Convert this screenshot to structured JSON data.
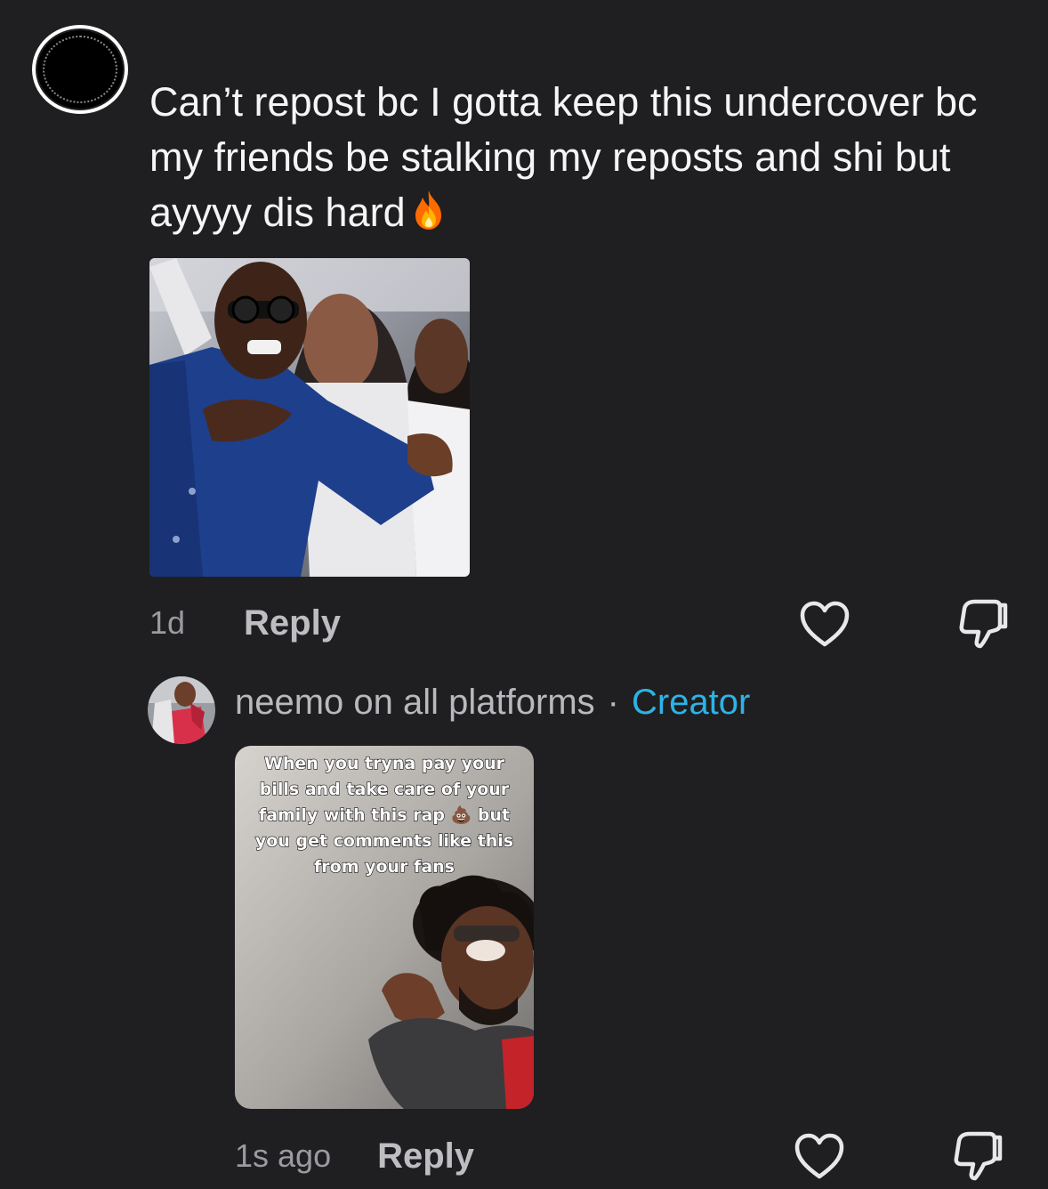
{
  "comments": [
    {
      "text": "Can’t repost bc I gotta keep this undercover bc my friends be stalking my reposts and shi but ayyyy dis hard",
      "emoji_icon": "fire-icon",
      "time": "1d",
      "reply_label": "Reply"
    },
    {
      "username": "neemo on all platforms",
      "separator": "·",
      "badge": "Creator",
      "video_caption": "When you tryna pay your bills and take care of your family with this rap 💩 but you get comments like this from your fans",
      "time": "1s ago",
      "reply_label": "Reply"
    }
  ],
  "colors": {
    "background": "#1f1f21",
    "text": "#f5f5f5",
    "muted": "#9a9aa0",
    "creator": "#2db3e6"
  },
  "icons": [
    "heart-outline-icon",
    "thumbs-down-outline-icon",
    "fire-icon"
  ]
}
